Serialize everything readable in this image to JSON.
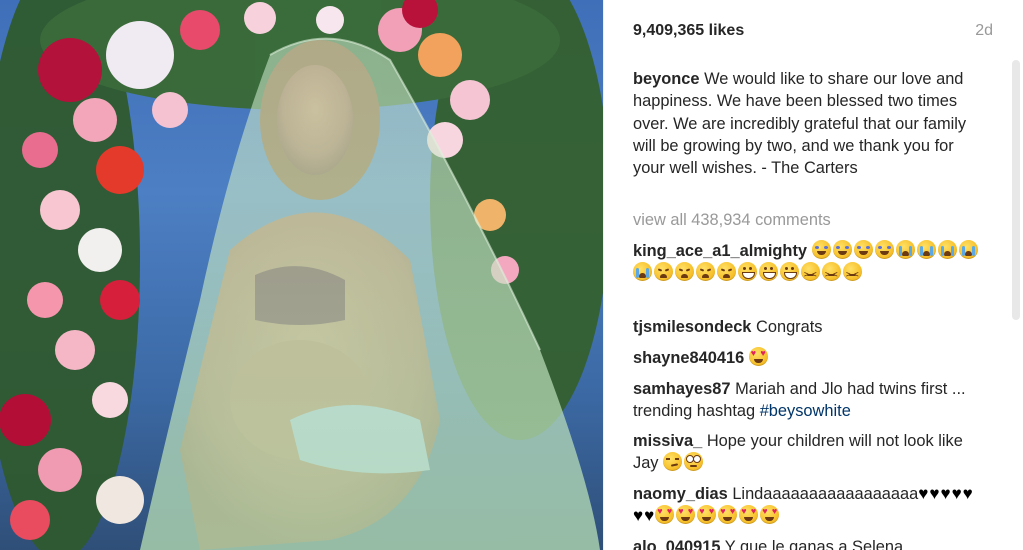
{
  "post": {
    "likes": "9,409,365 likes",
    "age": "2d",
    "caption": {
      "user": "beyonce",
      "text": "We would like to share our love and happiness. We have been blessed two times over. We are incredibly grateful that our family will be growing by two, and we thank you for your well wishes. - The Carters"
    },
    "view_all_comments": "view all 438,934 comments"
  },
  "comments": [
    {
      "user": "king_ace_a1_almighty",
      "text": "",
      "emojis": [
        "laugh",
        "laugh",
        "laugh",
        "laugh",
        "sob",
        "sob",
        "sob",
        "sob",
        "sob",
        "weary",
        "weary",
        "weary",
        "weary",
        "grin",
        "grin",
        "grin",
        "persevere",
        "persevere",
        "persevere"
      ]
    },
    {
      "user": "tjsmilesondeck",
      "text": "Congrats"
    },
    {
      "user": "shayne840416",
      "text": "",
      "emojis": [
        "hearteyes"
      ]
    },
    {
      "user": "samhayes87",
      "text": "Mariah and Jlo had twins first ... trending hashtag",
      "hashtag": "#beysowhite"
    },
    {
      "user": "missiva_",
      "text": "Hope your children will not look like Jay",
      "emojis": [
        "smirk",
        "rolling"
      ]
    },
    {
      "user": "naomy_dias",
      "text": "Lindaaaaaaaaaaaaaaaaa",
      "hearts": 7,
      "emojis": [
        "hearteyes",
        "hearteyes",
        "hearteyes",
        "hearteyes",
        "hearteyes",
        "hearteyes"
      ]
    },
    {
      "user": "alo_040915",
      "text": "Y que le ganas a Selena"
    }
  ],
  "icons": {
    "heart": "black-heart-icon",
    "emoji_types": [
      "laugh",
      "sob",
      "weary",
      "grin",
      "persevere",
      "hearteyes",
      "smirk",
      "rolling"
    ]
  },
  "colors": {
    "text": "#262626",
    "muted": "#999999",
    "hashtag": "#003569",
    "photo_sky": "#4d7fc4",
    "veil": "#bfe3b8"
  }
}
